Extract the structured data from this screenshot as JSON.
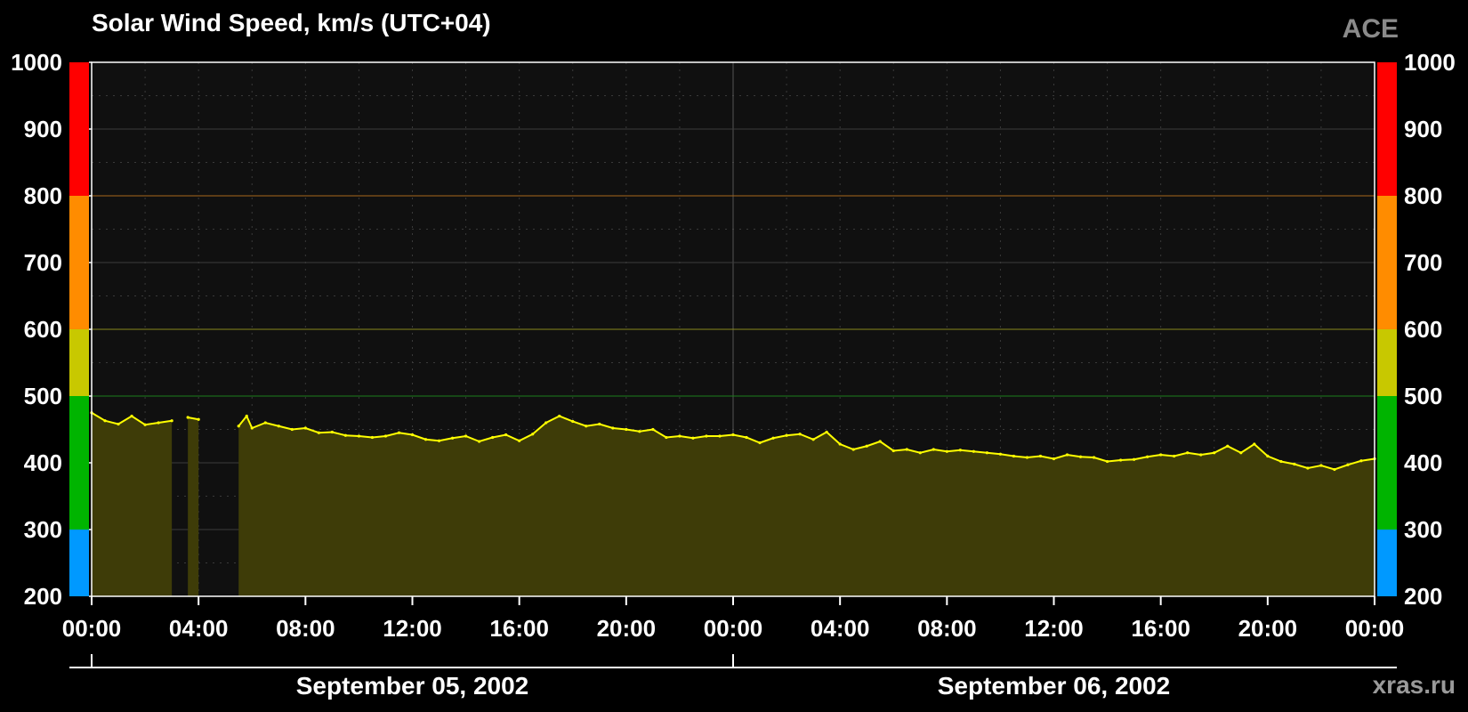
{
  "title": "Solar Wind Speed, km/s (UTC+04)",
  "source_label": "ACE",
  "watermark": "xras.ru",
  "chart_data": {
    "type": "area",
    "title": "Solar Wind Speed, km/s (UTC+04)",
    "source": "ACE",
    "xlabel": "",
    "ylabel": "",
    "ylim": [
      200,
      1000
    ],
    "y_ticks": [
      200,
      300,
      400,
      500,
      600,
      700,
      800,
      900,
      1000
    ],
    "y_tick_labels": [
      "200",
      "300",
      "400",
      "500",
      "600",
      "700",
      "800",
      "900",
      "1000"
    ],
    "x_range_hours": [
      0,
      48
    ],
    "x_ticks_hours": [
      0,
      4,
      8,
      12,
      16,
      20,
      24,
      28,
      32,
      36,
      40,
      44,
      48
    ],
    "x_tick_labels": [
      "00:00",
      "04:00",
      "08:00",
      "12:00",
      "16:00",
      "20:00",
      "00:00",
      "04:00",
      "08:00",
      "12:00",
      "16:00",
      "20:00",
      "00:00"
    ],
    "date_labels": [
      {
        "text": "September 05, 2002",
        "start_hour": 0,
        "end_hour": 24
      },
      {
        "text": "September 06, 2002",
        "start_hour": 24,
        "end_hour": 48
      }
    ],
    "threshold_bands": [
      {
        "from": 200,
        "to": 300,
        "color": "#0099ff"
      },
      {
        "from": 300,
        "to": 500,
        "color": "#00b400"
      },
      {
        "from": 500,
        "to": 600,
        "color": "#c8c800"
      },
      {
        "from": 600,
        "to": 800,
        "color": "#ff8c00"
      },
      {
        "from": 800,
        "to": 1000,
        "color": "#ff0000"
      }
    ],
    "threshold_lines": [
      500,
      600,
      800
    ],
    "grid": true,
    "series": [
      {
        "line_color": "#ffff00",
        "fill_color": "#3e3c08",
        "x_hours": [
          0,
          0.5,
          1,
          1.5,
          2,
          2.5,
          3,
          3.3,
          3.6,
          4.0,
          5.2,
          5.5,
          5.8,
          6.0,
          6.5,
          7,
          7.5,
          8,
          8.5,
          9,
          9.5,
          10,
          10.5,
          11,
          11.5,
          12,
          12.5,
          13,
          13.5,
          14,
          14.5,
          15,
          15.5,
          16,
          16.5,
          17,
          17.5,
          18,
          18.5,
          19,
          19.5,
          20,
          20.5,
          21,
          21.5,
          22,
          22.5,
          23,
          23.5,
          24,
          24.5,
          25,
          25.5,
          26,
          26.5,
          27,
          27.5,
          28,
          28.5,
          29,
          29.5,
          30,
          30.5,
          31,
          31.5,
          32,
          32.5,
          33,
          33.5,
          34,
          34.5,
          35,
          35.5,
          36,
          36.5,
          37,
          37.5,
          38,
          38.5,
          39,
          39.5,
          40,
          40.5,
          41,
          41.5,
          42,
          42.5,
          43,
          43.5,
          44,
          44.5,
          45,
          45.5,
          46,
          46.5,
          47,
          47.5,
          48
        ],
        "values": [
          475,
          463,
          458,
          470,
          457,
          460,
          463,
          null,
          468,
          465,
          null,
          455,
          470,
          452,
          460,
          455,
          450,
          452,
          445,
          446,
          441,
          440,
          438,
          440,
          445,
          442,
          435,
          433,
          437,
          440,
          432,
          438,
          442,
          433,
          443,
          460,
          470,
          462,
          455,
          458,
          452,
          450,
          447,
          450,
          438,
          440,
          437,
          440,
          440,
          442,
          438,
          430,
          437,
          441,
          443,
          435,
          446,
          428,
          420,
          425,
          432,
          418,
          420,
          415,
          420,
          417,
          419,
          417,
          415,
          413,
          410,
          408,
          410,
          406,
          412,
          409,
          408,
          402,
          404,
          405,
          409,
          412,
          410,
          415,
          412,
          415,
          425,
          415,
          428,
          410,
          402,
          398,
          392,
          396,
          390,
          397,
          403,
          406,
          394
        ]
      }
    ]
  }
}
